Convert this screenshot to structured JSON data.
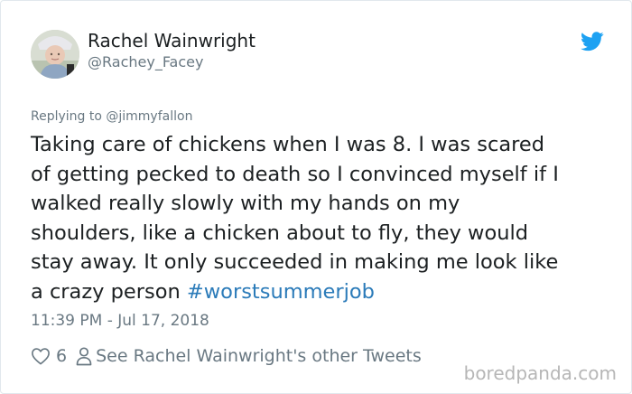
{
  "author": {
    "display_name": "Rachel Wainwright",
    "handle": "@Rachey_Facey",
    "avatar_icon": "profile-photo"
  },
  "brand": {
    "icon": "twitter-bird-icon",
    "color": "#1da1f2"
  },
  "reply": {
    "text": "Replying to @jimmyfallon"
  },
  "tweet": {
    "lines": [
      "Taking care of chickens when I was 8. I was scared",
      "of getting pecked to death so I convinced myself if I",
      "walked really slowly with my hands on my",
      "shoulders, like a chicken about to fly, they would",
      "stay away. It only succeeded in making me look like",
      "a crazy person"
    ],
    "hashtag": "#worstsummerjob",
    "hashtag_color": "#2b7bb9",
    "timestamp": "11:39 PM - Jul 17, 2018"
  },
  "actions": {
    "like_icon": "heart-icon",
    "like_count": "6",
    "profile_icon": "person-icon",
    "other_tweets_label": "See Rachel Wainwright's other Tweets"
  },
  "watermark": {
    "text": "boredpanda.com"
  }
}
